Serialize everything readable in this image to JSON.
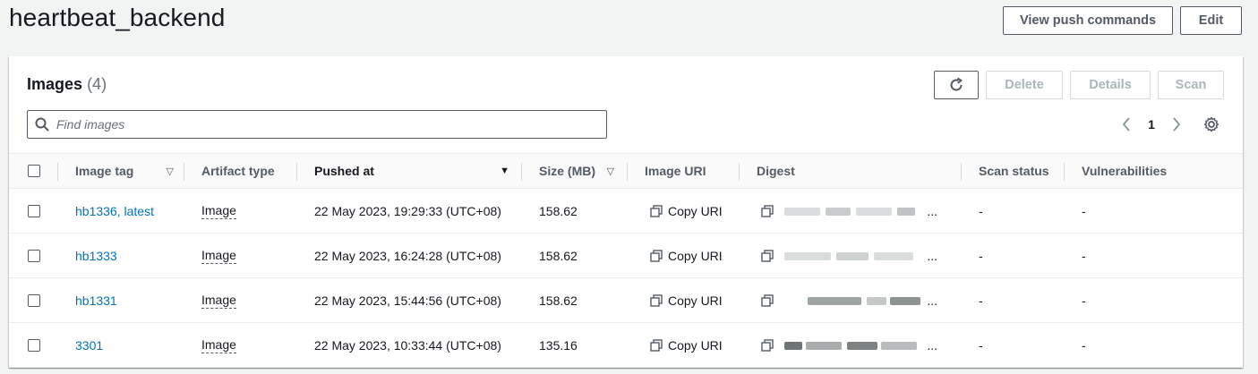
{
  "header": {
    "title": "heartbeat_backend",
    "view_push_label": "View push commands",
    "edit_label": "Edit"
  },
  "panel": {
    "title": "Images",
    "count": "(4)",
    "delete_label": "Delete",
    "details_label": "Details",
    "scan_label": "Scan",
    "search_placeholder": "Find images",
    "page_number": "1"
  },
  "table": {
    "columns": [
      {
        "label": "Image tag",
        "sort": "▽"
      },
      {
        "label": "Artifact type"
      },
      {
        "label": "Pushed at",
        "sort": "▼"
      },
      {
        "label": "Size (MB)",
        "sort": "▽"
      },
      {
        "label": "Image URI"
      },
      {
        "label": "Digest"
      },
      {
        "label": "Scan status"
      },
      {
        "label": "Vulnerabilities"
      }
    ],
    "rows": [
      {
        "tag": "hb1336, latest",
        "type": "Image",
        "pushed": "22 May 2023, 19:29:33 (UTC+08)",
        "size": "158.62",
        "uri": "Copy URI",
        "digest_tail": "...",
        "scan": "-",
        "vuln": "-"
      },
      {
        "tag": "hb1333",
        "type": "Image",
        "pushed": "22 May 2023, 16:24:28 (UTC+08)",
        "size": "158.62",
        "uri": "Copy URI",
        "digest_tail": "...",
        "scan": "-",
        "vuln": "-"
      },
      {
        "tag": "hb1331",
        "type": "Image",
        "pushed": "22 May 2023, 15:44:56 (UTC+08)",
        "size": "158.62",
        "uri": "Copy URI",
        "digest_tail": "...",
        "scan": "-",
        "vuln": "-"
      },
      {
        "tag": "3301",
        "type": "Image",
        "pushed": "22 May 2023, 10:33:44 (UTC+08)",
        "size": "135.16",
        "uri": "Copy URI",
        "digest_tail": "...",
        "scan": "-",
        "vuln": "-"
      }
    ]
  },
  "icons": {
    "search": "search-icon",
    "refresh": "refresh-icon",
    "prev": "chevron-left-icon",
    "next": "chevron-right-icon",
    "settings": "gear-icon",
    "copy": "copy-icon"
  },
  "colors": {
    "link": "#0073bb",
    "text": "#16191f",
    "disabled": "#aab7b8",
    "background": "#f2f3f3"
  }
}
